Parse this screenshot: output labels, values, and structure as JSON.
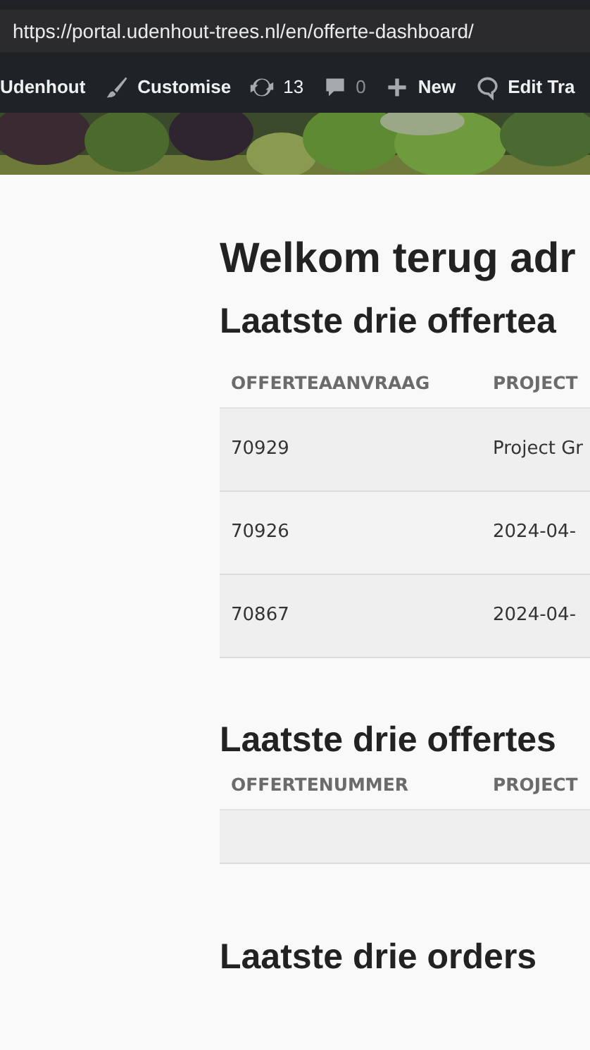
{
  "browser": {
    "url": "https://portal.udenhout-trees.nl/en/offerte-dashboard/"
  },
  "admin_bar": [
    {
      "kind": "site",
      "label": "Udenhout"
    },
    {
      "kind": "customise",
      "label": "Customise"
    },
    {
      "kind": "updates",
      "label": "13"
    },
    {
      "kind": "comments",
      "label": "0"
    },
    {
      "kind": "new",
      "label": "New"
    },
    {
      "kind": "translate",
      "label": "Edit Tra"
    }
  ],
  "welcome": "Welkom terug adr",
  "sections": [
    {
      "title": "Laatste drie offertea",
      "columns": [
        "OFFERTEAANVRAAG",
        "PROJECT"
      ],
      "rows": [
        [
          "70929",
          "Project Gr"
        ],
        [
          "70926",
          "2024-04-"
        ],
        [
          "70867",
          "2024-04-"
        ]
      ]
    },
    {
      "title": "Laatste drie offertes",
      "columns": [
        "OFFERTENUMMER",
        "PROJECT"
      ],
      "rows": [
        [
          "",
          ""
        ]
      ]
    },
    {
      "title": "Laatste drie orders"
    }
  ]
}
